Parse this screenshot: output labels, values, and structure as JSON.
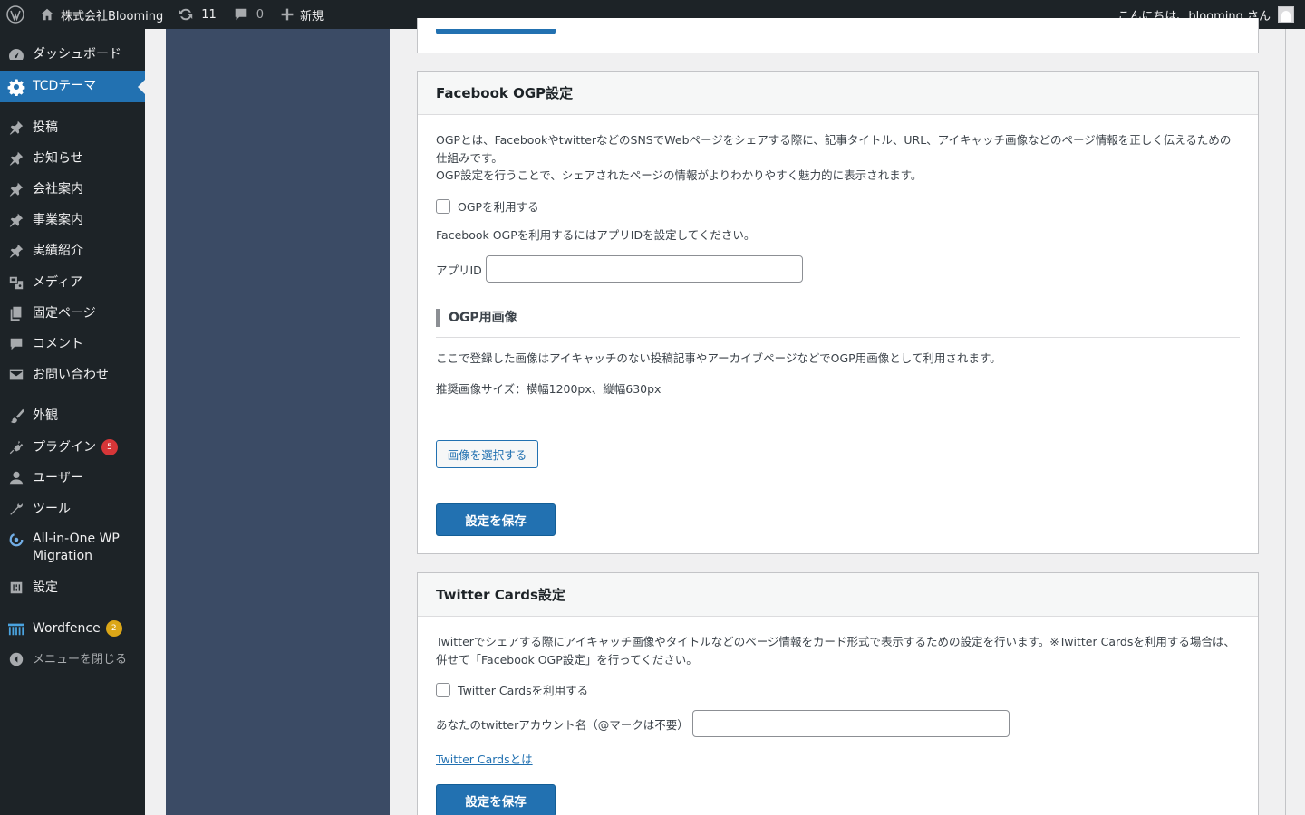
{
  "adminbar": {
    "site_name": "株式会社Blooming",
    "updates_count": "11",
    "comments_count": "0",
    "new_label": "新規",
    "greeting": "こんにちは、blooming さん"
  },
  "menu": {
    "dashboard": "ダッシュボード",
    "tcd_theme": "TCDテーマ",
    "posts": "投稿",
    "news": "お知らせ",
    "company": "会社案内",
    "business": "事業案内",
    "works": "実績紹介",
    "media": "メディア",
    "pages": "固定ページ",
    "comments": "コメント",
    "contact": "お問い合わせ",
    "appearance": "外観",
    "plugins": "プラグイン",
    "plugins_badge": "5",
    "users": "ユーザー",
    "tools": "ツール",
    "aiowp_line1": "All-in-One WP",
    "aiowp_line2": "Migration",
    "settings": "設定",
    "wordfence": "Wordfence",
    "wordfence_badge": "2",
    "collapse": "メニューを閉じる"
  },
  "facebook": {
    "title": "Facebook OGP設定",
    "desc_line1": "OGPとは、FacebookやtwitterなどのSNSでWebページをシェアする際に、記事タイトル、URL、アイキャッチ画像などのページ情報を正しく伝えるための仕組みです。",
    "desc_line2": "OGP設定を行うことで、シェアされたページの情報がよりわかりやすく魅力的に表示されます。",
    "use_ogp_label": "OGPを利用する",
    "app_id_note": "Facebook OGPを利用するにはアプリIDを設定してください。",
    "app_id_label": "アプリID",
    "app_id_value": "",
    "ogp_image_heading": "OGP用画像",
    "ogp_image_desc": "ここで登録した画像はアイキャッチのない投稿記事やアーカイブページなどでOGP用画像として利用されます。",
    "recommended_size": "推奨画像サイズ：横幅1200px、縦幅630px",
    "select_image_button": "画像を選択する",
    "save_button": "設定を保存"
  },
  "twitter": {
    "title": "Twitter Cards設定",
    "desc": "Twitterでシェアする際にアイキャッチ画像やタイトルなどのページ情報をカード形式で表示するための設定を行います。※Twitter Cardsを利用する場合は、併せて「Facebook OGP設定」を行ってください。",
    "use_cards_label": "Twitter Cardsを利用する",
    "account_label": "あなたのtwitterアカウント名（@マークは不要）",
    "account_value": "",
    "about_link": "Twitter Cardsとは",
    "save_button": "設定を保存"
  },
  "colors": {
    "adminbar_bg": "#1d2327",
    "active_menu": "#2271b1",
    "content_band": "#3b4b65",
    "badge_red": "#d63638",
    "badge_orange": "#dba617"
  }
}
